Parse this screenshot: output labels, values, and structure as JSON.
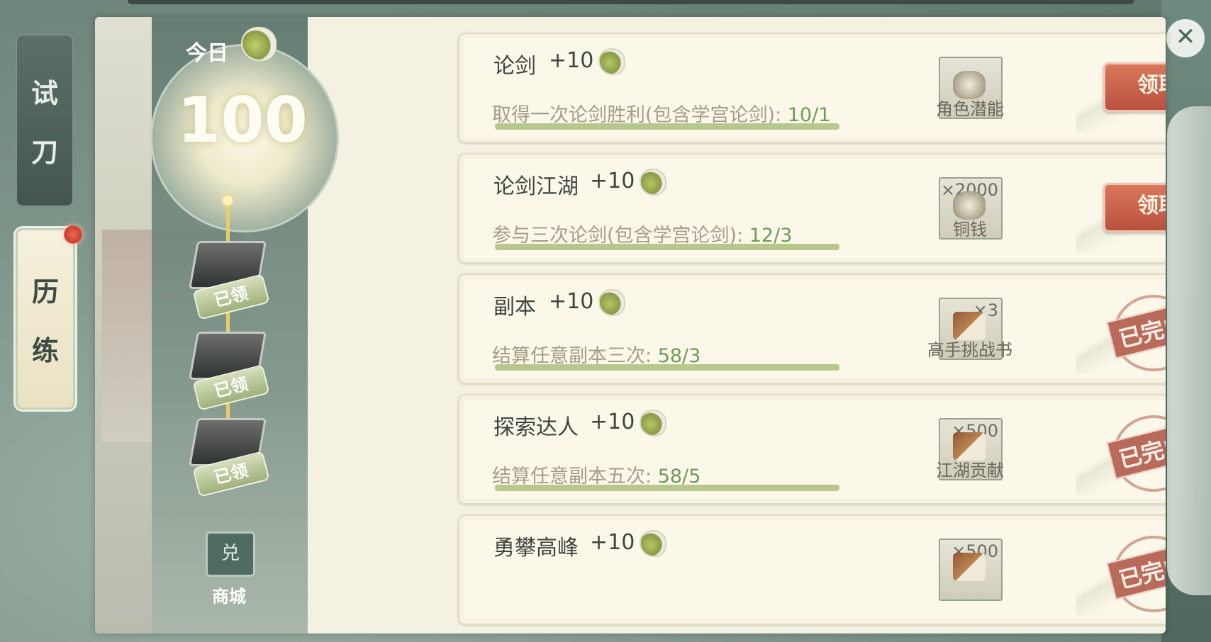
{
  "side_tabs": {
    "trial": [
      "试",
      "刀"
    ],
    "training": [
      "历",
      "练"
    ]
  },
  "progress": {
    "today_label": "今日",
    "score": "100",
    "claimed_label": "已领",
    "shop_label": "商城",
    "shop_icon_char": "兑"
  },
  "close_icon": "✕",
  "tasks": [
    {
      "title": "论剑",
      "points": "+10",
      "desc": "取得一次论剑胜利(包含学宫论剑): ",
      "progress": "10/1",
      "reward_qty": "",
      "reward_name": "角色潜能",
      "status": "领取"
    },
    {
      "title": "论剑江湖",
      "points": "+10",
      "desc": "参与三次论剑(包含学宫论剑): ",
      "progress": "12/3",
      "reward_qty": "×2000",
      "reward_name": "铜钱",
      "status": "领取"
    },
    {
      "title": "副本",
      "points": "+10",
      "desc": "结算任意副本三次: ",
      "progress": "58/3",
      "reward_qty": "×3",
      "reward_name": "高手挑战书",
      "status": "已完成"
    },
    {
      "title": "探索达人",
      "points": "+10",
      "desc": "结算任意副本五次: ",
      "progress": "58/5",
      "reward_qty": "×500",
      "reward_name": "江湖贡献",
      "status": "已完成"
    },
    {
      "title": "勇攀高峰",
      "points": "+10",
      "desc": "",
      "progress": "",
      "reward_qty": "×500",
      "reward_name": "",
      "status": "已完成"
    }
  ],
  "colors": {
    "claim_button": "#c25e46",
    "done_stamp": "#b96b5b",
    "progress_fill": "#b7c78d",
    "panel_bg": "#f4f1e3"
  }
}
